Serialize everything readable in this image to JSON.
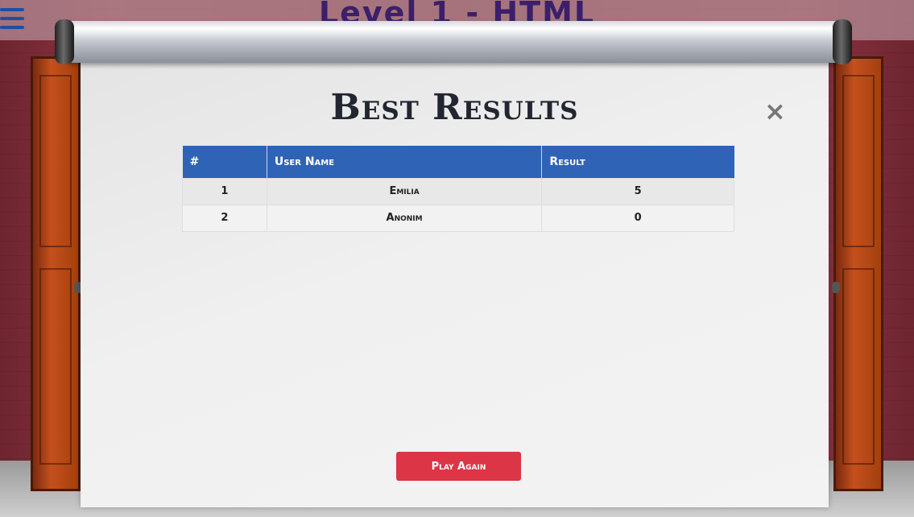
{
  "header": {
    "menu_icon": "hamburger-icon",
    "level_title": "Level 1 - HTML"
  },
  "modal": {
    "title": "Best Results",
    "close_icon": "close-icon",
    "close_label": "×",
    "table": {
      "columns": [
        "#",
        "User Name",
        "Result"
      ],
      "rows": [
        {
          "rank": "1",
          "user": "Emilia",
          "result": "5"
        },
        {
          "rank": "2",
          "user": "Anonim",
          "result": "0"
        }
      ]
    },
    "play_again_label": "Play Again"
  },
  "colors": {
    "header_accent": "#2e63b6",
    "play_button": "#dc3545",
    "title_text": "#222630"
  }
}
